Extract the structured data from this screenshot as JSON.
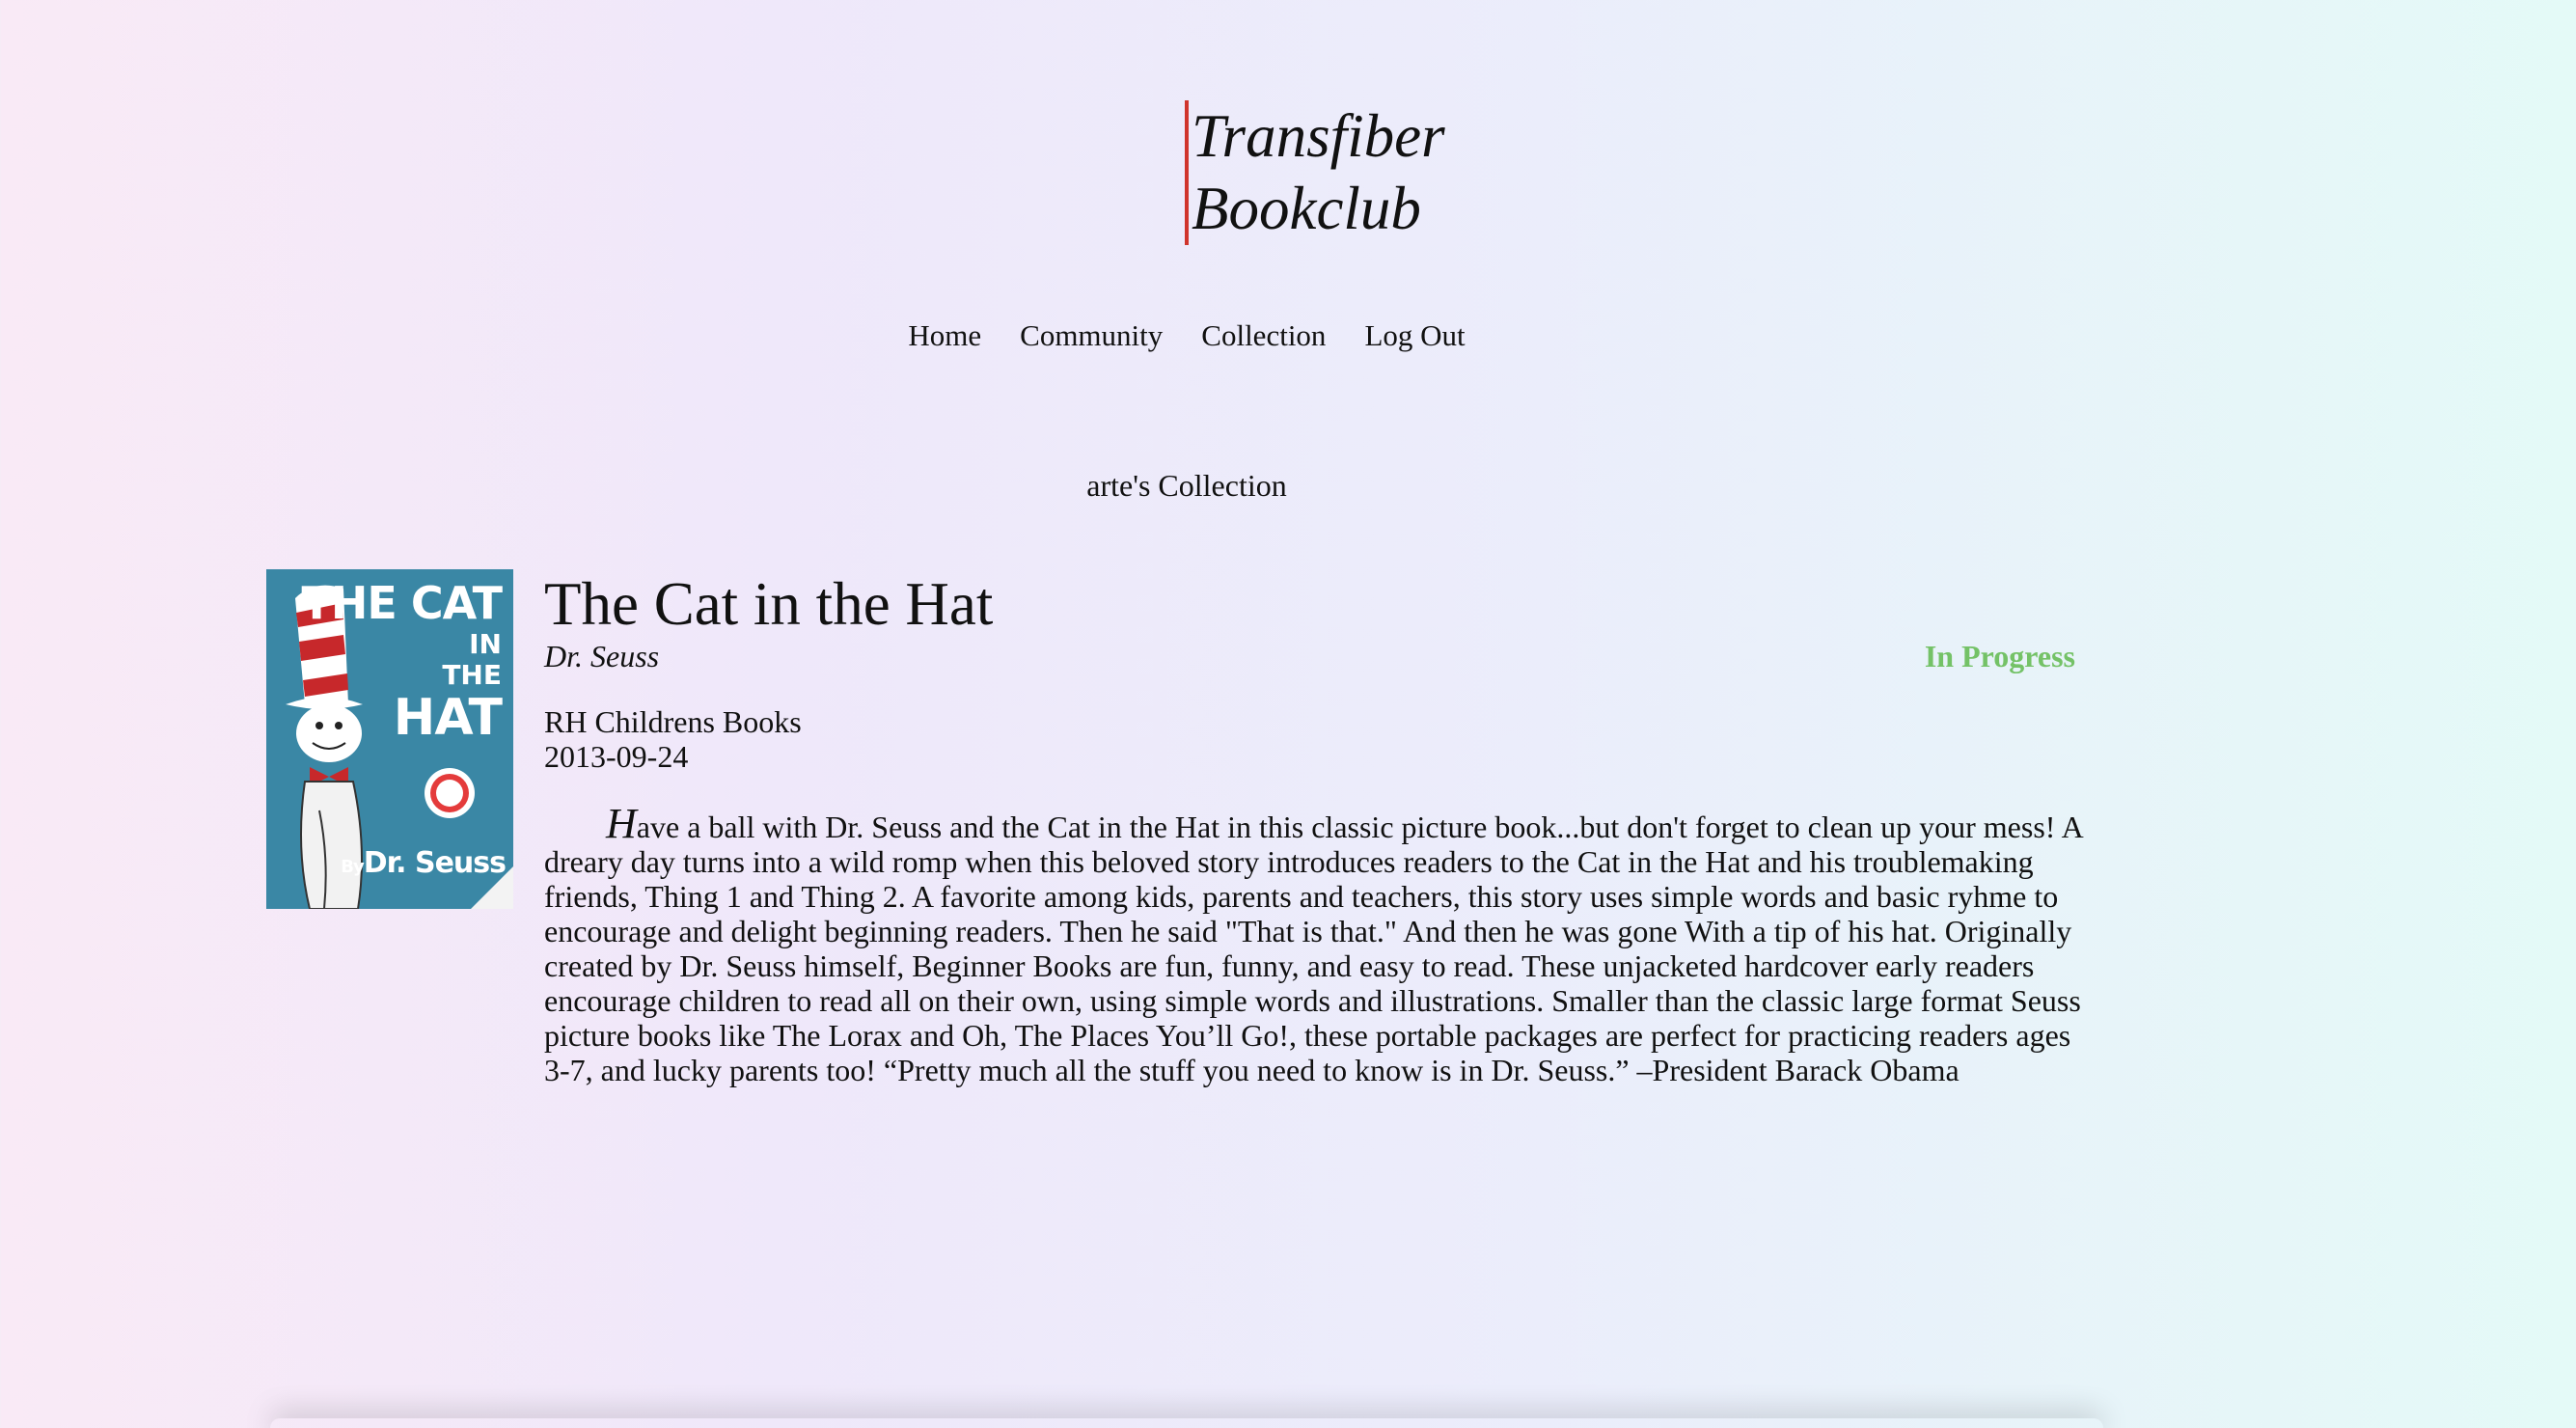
{
  "site": {
    "title_line1": "Transfiber",
    "title_line2": "Bookclub"
  },
  "nav": {
    "items": [
      "Home",
      "Community",
      "Collection",
      "Log Out"
    ]
  },
  "collection": {
    "heading": "arte's Collection"
  },
  "book": {
    "cover": {
      "line1": "THE CAT",
      "line2": "IN",
      "line3": "THE",
      "line4": "HAT",
      "author_prefix": "By",
      "author": "Dr. Seuss"
    },
    "title": "The Cat in the Hat",
    "author": "Dr. Seuss",
    "status": "In Progress",
    "publisher": "RH Childrens Books",
    "published_date": "2013-09-24",
    "description": "Have a ball with Dr. Seuss and the Cat in the Hat in this classic picture book...but don't forget to clean up your mess! A dreary day turns into a wild romp when this beloved story introduces readers to the Cat in the Hat and his troublemaking friends, Thing 1 and Thing 2. A favorite among kids, parents and teachers, this story uses simple words and basic ryhme to encourage and delight beginning readers. Then he said \"That is that.\" And then he was gone With a tip of his hat. Originally created by Dr. Seuss himself, Beginner Books are fun, funny, and easy to read. These unjacketed hardcover early readers encourage children to read all on their own, using simple words and illustrations. Smaller than the classic large format Seuss picture books like The Lorax and Oh, The Places You’ll Go!, these portable packages are perfect for practicing readers ages 3-7, and lucky parents too! “Pretty much all the stuff you need to know is in Dr. Seuss.” –President Barack Obama"
  },
  "colors": {
    "status": "#74c267",
    "title_accent_bar": "#d0342c",
    "cover_background": "#3a87a5"
  }
}
